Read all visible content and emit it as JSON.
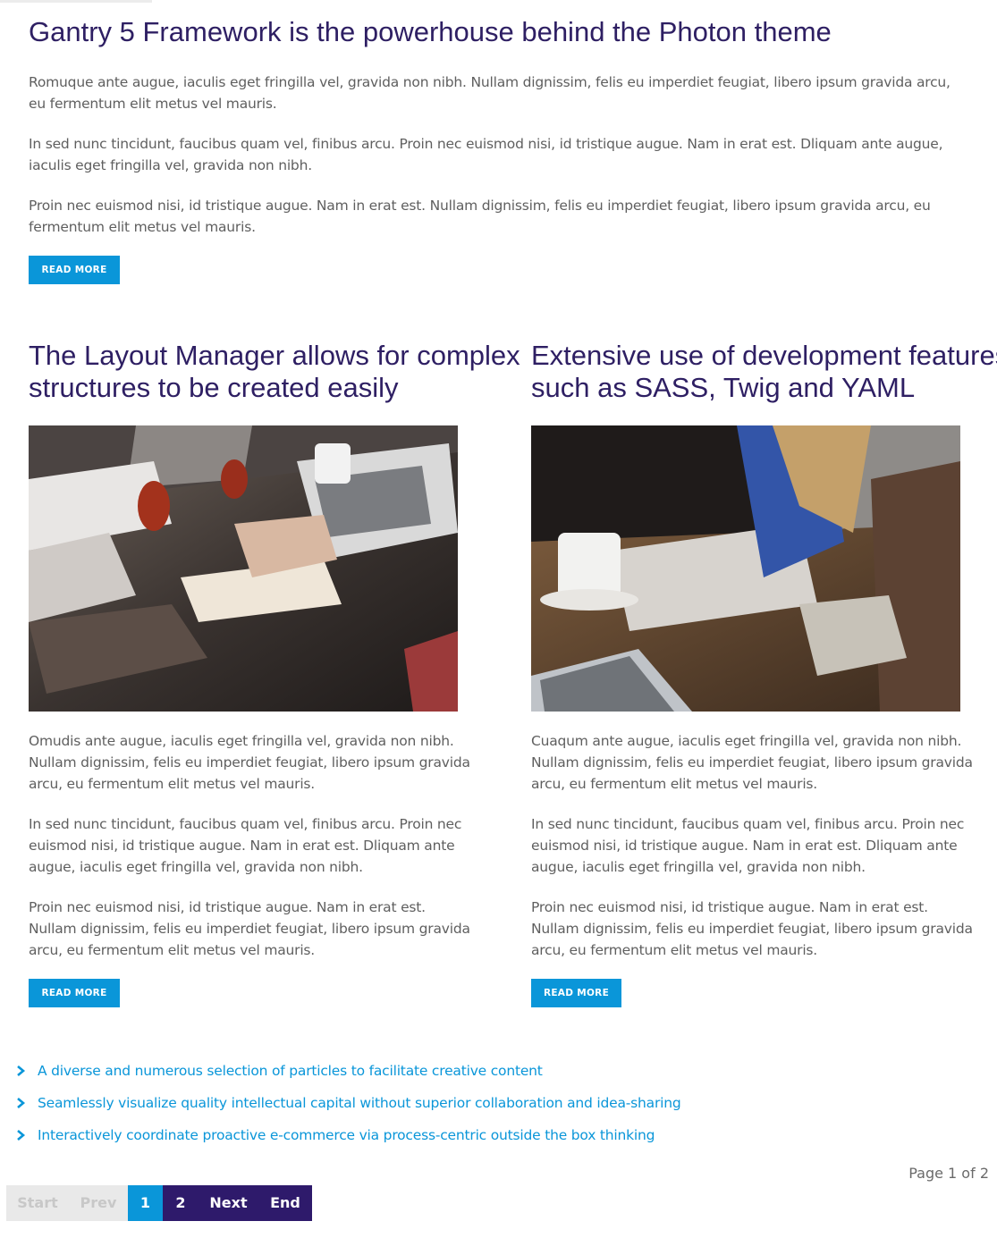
{
  "article_main": {
    "title": "Gantry 5 Framework is the powerhouse behind the Photon theme",
    "paragraphs": [
      "Romuque ante augue, iaculis eget fringilla vel, gravida non nibh. Nullam dignissim, felis eu imperdiet feugiat, libero ipsum gravida arcu, eu fermentum elit metus vel mauris.",
      "In sed nunc tincidunt, faucibus quam vel, finibus arcu. Proin nec euismod nisi, id tristique augue. Nam in erat est. Dliquam ante augue, iaculis eget fringilla vel, gravida non nibh.",
      "Proin nec euismod nisi, id tristique augue. Nam in erat est. Nullam dignissim, felis eu imperdiet feugiat, libero ipsum gravida arcu, eu fermentum elit metus vel mauris."
    ],
    "read_more": "READ MORE"
  },
  "article_left": {
    "title_line1": "The Layout Manager allows for complex",
    "title_line2": "structures to be created easily",
    "paragraphs": [
      "Omudis ante augue, iaculis eget fringilla vel, gravida non nibh. Nullam dignissim, felis eu imperdiet feugiat, libero ipsum gravida arcu, eu fermentum elit metus vel mauris.",
      "In sed nunc tincidunt, faucibus quam vel, finibus arcu. Proin nec euismod nisi, id tristique augue. Nam in erat est. Dliquam ante augue, iaculis eget fringilla vel, gravida non nibh.",
      "Proin nec euismod nisi, id tristique augue. Nam in erat est. Nullam dignissim, felis eu imperdiet feugiat, libero ipsum gravida arcu, eu fermentum elit metus vel mauris."
    ],
    "read_more": "READ MORE"
  },
  "article_right": {
    "title_line1": "Extensive use of development features",
    "title_line2": "such as SASS, Twig and YAML",
    "paragraphs": [
      "Cuaqum ante augue, iaculis eget fringilla vel, gravida non nibh. Nullam dignissim, felis eu imperdiet feugiat, libero ipsum gravida arcu, eu fermentum elit metus vel mauris.",
      "In sed nunc tincidunt, faucibus quam vel, finibus arcu. Proin nec euismod nisi, id tristique augue. Nam in erat est. Dliquam ante augue, iaculis eget fringilla vel, gravida non nibh.",
      "Proin nec euismod nisi, id tristique augue. Nam in erat est. Nullam dignissim, felis eu imperdiet feugiat, libero ipsum gravida arcu, eu fermentum elit metus vel mauris."
    ],
    "read_more": "READ MORE"
  },
  "more_links": [
    "A diverse and numerous selection of particles to facilitate creative content",
    "Seamlessly visualize quality intellectual capital without superior collaboration and idea-sharing",
    "Interactively coordinate proactive e-commerce via process-centric outside the box thinking"
  ],
  "pagination": {
    "page_info": "Page 1 of 2",
    "start": "Start",
    "prev": "Prev",
    "page1": "1",
    "page2": "2",
    "next": "Next",
    "end": "End"
  },
  "colors": {
    "accent": "#0a96d9",
    "heading": "#2e1f63",
    "pager_dark": "#2e1a6b"
  }
}
